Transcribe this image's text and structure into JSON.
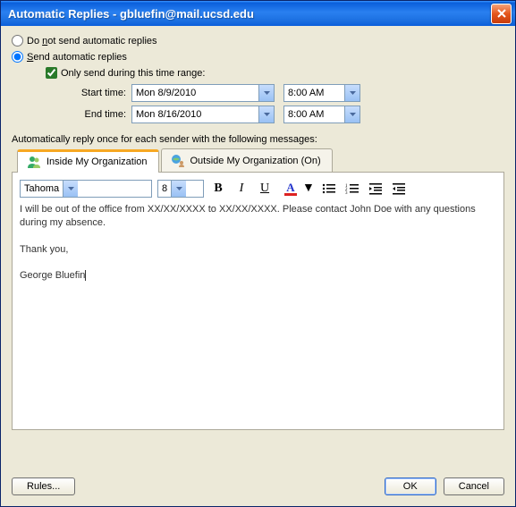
{
  "window": {
    "title": "Automatic Replies - gbluefin@mail.ucsd.edu"
  },
  "radios": {
    "dont_send_label_pre": "Do ",
    "dont_send_label_u": "n",
    "dont_send_label_post": "ot send automatic replies",
    "send_label_pre": "",
    "send_label_u": "S",
    "send_label_post": "end automatic replies"
  },
  "range": {
    "only_send_label": "Only send during this time range:",
    "start_label_pre": "Start ti",
    "start_label_u": "m",
    "start_label_post": "e:",
    "start_date": "Mon 8/9/2010",
    "start_time": "8:00 AM",
    "end_label_pre": "End tim",
    "end_label_u": "e",
    "end_label_post": ":",
    "end_date": "Mon 8/16/2010",
    "end_time": "8:00 AM"
  },
  "section_label": "Automatically reply once for each sender with the following messages:",
  "tabs": {
    "inside": "Inside My Organization",
    "outside": "Outside My Organization (On)"
  },
  "toolbar": {
    "font": "Tahoma",
    "size": "8"
  },
  "message": {
    "line1": "I will be out of the office from XX/XX/XXXX to XX/XX/XXXX.  Please contact John Doe with any questions during my absence.",
    "line2": "Thank you,",
    "line3": "George Bluefin"
  },
  "buttons": {
    "rules": "Rules...",
    "ok": "OK",
    "cancel": "Cancel"
  }
}
